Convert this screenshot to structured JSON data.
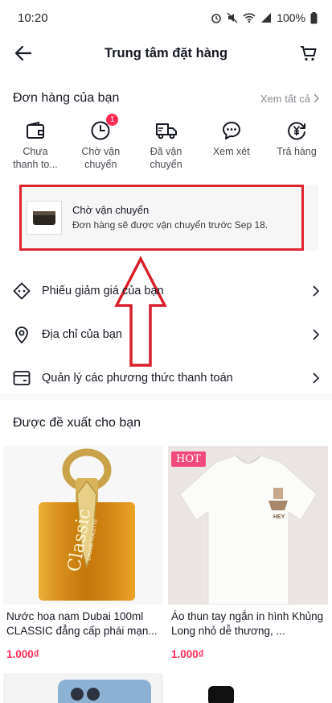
{
  "status_bar": {
    "time": "10:20",
    "battery": "100%"
  },
  "header": {
    "title": "Trung tâm đặt hàng"
  },
  "orders": {
    "title": "Đơn hàng của bạn",
    "see_all": "Xem tất cả",
    "statuses": [
      {
        "label": "Chưa\nthanh to...",
        "icon": "wallet-icon"
      },
      {
        "label": "Chờ vận\nchuyển",
        "icon": "clock-icon",
        "badge": "1"
      },
      {
        "label": "Đã vận\nchuyển",
        "icon": "truck-icon"
      },
      {
        "label": "Xem xét",
        "icon": "chat-bubble-icon"
      },
      {
        "label": "Trả hàng",
        "icon": "yen-return-icon"
      }
    ],
    "card": {
      "title": "Chờ vận chuyển",
      "subtitle": "Đơn hàng sẽ được vận chuyển trước Sep 18."
    }
  },
  "menu": [
    {
      "label": "Phiếu giảm giá của bạn",
      "icon": "voucher-icon"
    },
    {
      "label": "Địa chỉ của bạn",
      "icon": "location-pin-icon"
    },
    {
      "label": "Quản lý các phương thức thanh toán",
      "icon": "payment-card-icon"
    }
  ],
  "recommendations": {
    "title": "Được đề xuất cho bạn",
    "products": [
      {
        "name": "Nước hoa nam Dubai 100ml CLASSIC đẳng cấp phái mạn...",
        "price": "1.000₫",
        "image_text": "Classic",
        "image_subtext": "EAU DE TOILETTE"
      },
      {
        "name": "Áo thun tay ngắn in hình Khủng Long nhỏ dễ thương, ...",
        "price": "1.000₫",
        "tag": "HOT",
        "image_text": "HEY"
      }
    ]
  },
  "colors": {
    "accent": "#fe2c55",
    "highlight": "#e1252f"
  }
}
